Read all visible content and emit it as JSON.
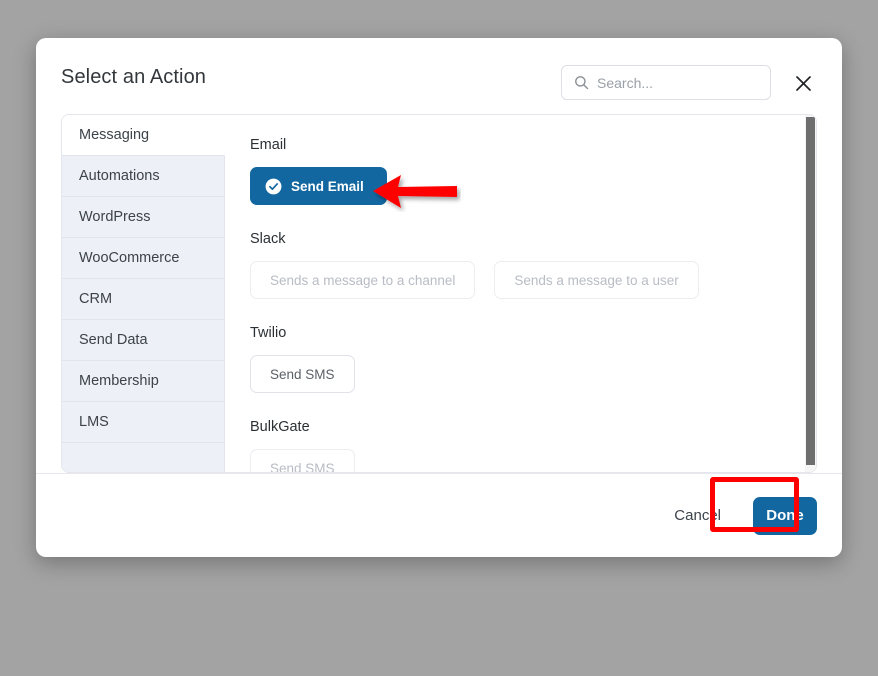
{
  "overlay": {
    "background_color": "#a3a3a3"
  },
  "modal": {
    "title": "Select an Action",
    "search": {
      "placeholder": "Search...",
      "value": "",
      "icon": "search-icon"
    },
    "close_icon": "close-icon",
    "sidebar": {
      "items": [
        {
          "label": "Messaging",
          "active": true
        },
        {
          "label": "Automations",
          "active": false
        },
        {
          "label": "WordPress",
          "active": false
        },
        {
          "label": "WooCommerce",
          "active": false
        },
        {
          "label": "CRM",
          "active": false
        },
        {
          "label": "Send Data",
          "active": false
        },
        {
          "label": "Membership",
          "active": false
        },
        {
          "label": "LMS",
          "active": false
        }
      ]
    },
    "content": {
      "groups": [
        {
          "title": "Email",
          "actions": [
            {
              "label": "Send Email",
              "state": "selected",
              "icon": "check-circle-icon"
            }
          ]
        },
        {
          "title": "Slack",
          "actions": [
            {
              "label": "Sends a message to a channel",
              "state": "muted"
            },
            {
              "label": "Sends a message to a user",
              "state": "muted"
            }
          ]
        },
        {
          "title": "Twilio",
          "actions": [
            {
              "label": "Send SMS",
              "state": "normal"
            }
          ]
        },
        {
          "title": "BulkGate",
          "actions": [
            {
              "label": "Send SMS",
              "state": "muted"
            }
          ]
        }
      ],
      "scrollbar": {
        "visible": true,
        "position": "top"
      }
    },
    "footer": {
      "cancel_label": "Cancel",
      "done_label": "Done"
    }
  },
  "annotations": {
    "highlight_color": "#fe0000",
    "arrow": {
      "direction": "left",
      "color": "#fe0000",
      "points_at": "Send Email"
    },
    "box": {
      "color": "#fe0000",
      "surrounds": "Done"
    }
  },
  "colors": {
    "accent_blue": "#1267a0",
    "sidebar_bg": "#eef0f7",
    "text_primary": "#32373c",
    "text_muted": "#b8bcc4"
  }
}
